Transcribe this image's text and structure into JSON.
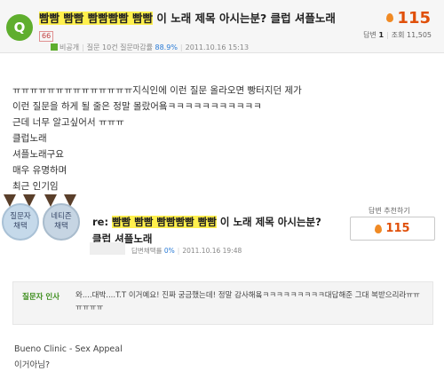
{
  "question": {
    "badge": "Q",
    "title_parts": [
      "빰빰 빰빰 빰빰빰빰 빰빰",
      " 이 노래 제목 아시는분? 클럽 셔플노래"
    ],
    "level": "66",
    "author": "비공개",
    "meta_stats": "질문 10건 질문마감률",
    "meta_rate": "88.9%",
    "date": "2011.10.16 15:13",
    "points": "115",
    "answers_label": "답변",
    "answers_count": "1",
    "views_label": "조회",
    "views_count": "11,505"
  },
  "body_lines": [
    "ㅠㅠㅠㅠㅠㅠㅠㅠㅠㅠㅠㅠㅠㅠ지식인에 이런 질문 올라오면 빵터지던 제가",
    "이런 질문을 하게 될 줄은 정말 몰랐어욬ㅋㅋㅋㅋㅋㅋㅋㅋㅋㅋㅋ",
    "근데 너무 알고싶어서 ㅠㅠㅠ",
    "클럽노래",
    "셔플노래구요",
    "매우 유명하며",
    "최근 인기임"
  ],
  "answer": {
    "medal1_line1": "질문자",
    "medal1_line2": "채택",
    "medal2_line1": "네티즌",
    "medal2_line2": "채택",
    "title_prefix": "re: ",
    "title_highlight": "빰빰 빰빰 빰빰빰빰 빰빰",
    "title_rest": " 이 노래 제목 아시는분? 클럽 셔플노래",
    "meta_label": "답변채택률",
    "meta_rate": "0%",
    "date": "2011.10.16 19:48",
    "vote_label": "답변 추천하기",
    "vote_points": "115"
  },
  "thanks": {
    "label": "질문자 인사",
    "text": "와....대박....T.T 이거예요! 진짜 궁금했는데! 정말 감사해욬ㅋㅋㅋㅋㅋㅋㅋㅋㅋ대답해준 그대 복받으리라ㅠㅠㅠㅠㅠㅠ"
  },
  "answer_body": [
    "Bueno Clinic - Sex Appeal",
    "이거아님?"
  ],
  "colors": {
    "accent_green": "#5fae2e",
    "points_orange": "#e0500a",
    "highlight": "#fff04d"
  }
}
